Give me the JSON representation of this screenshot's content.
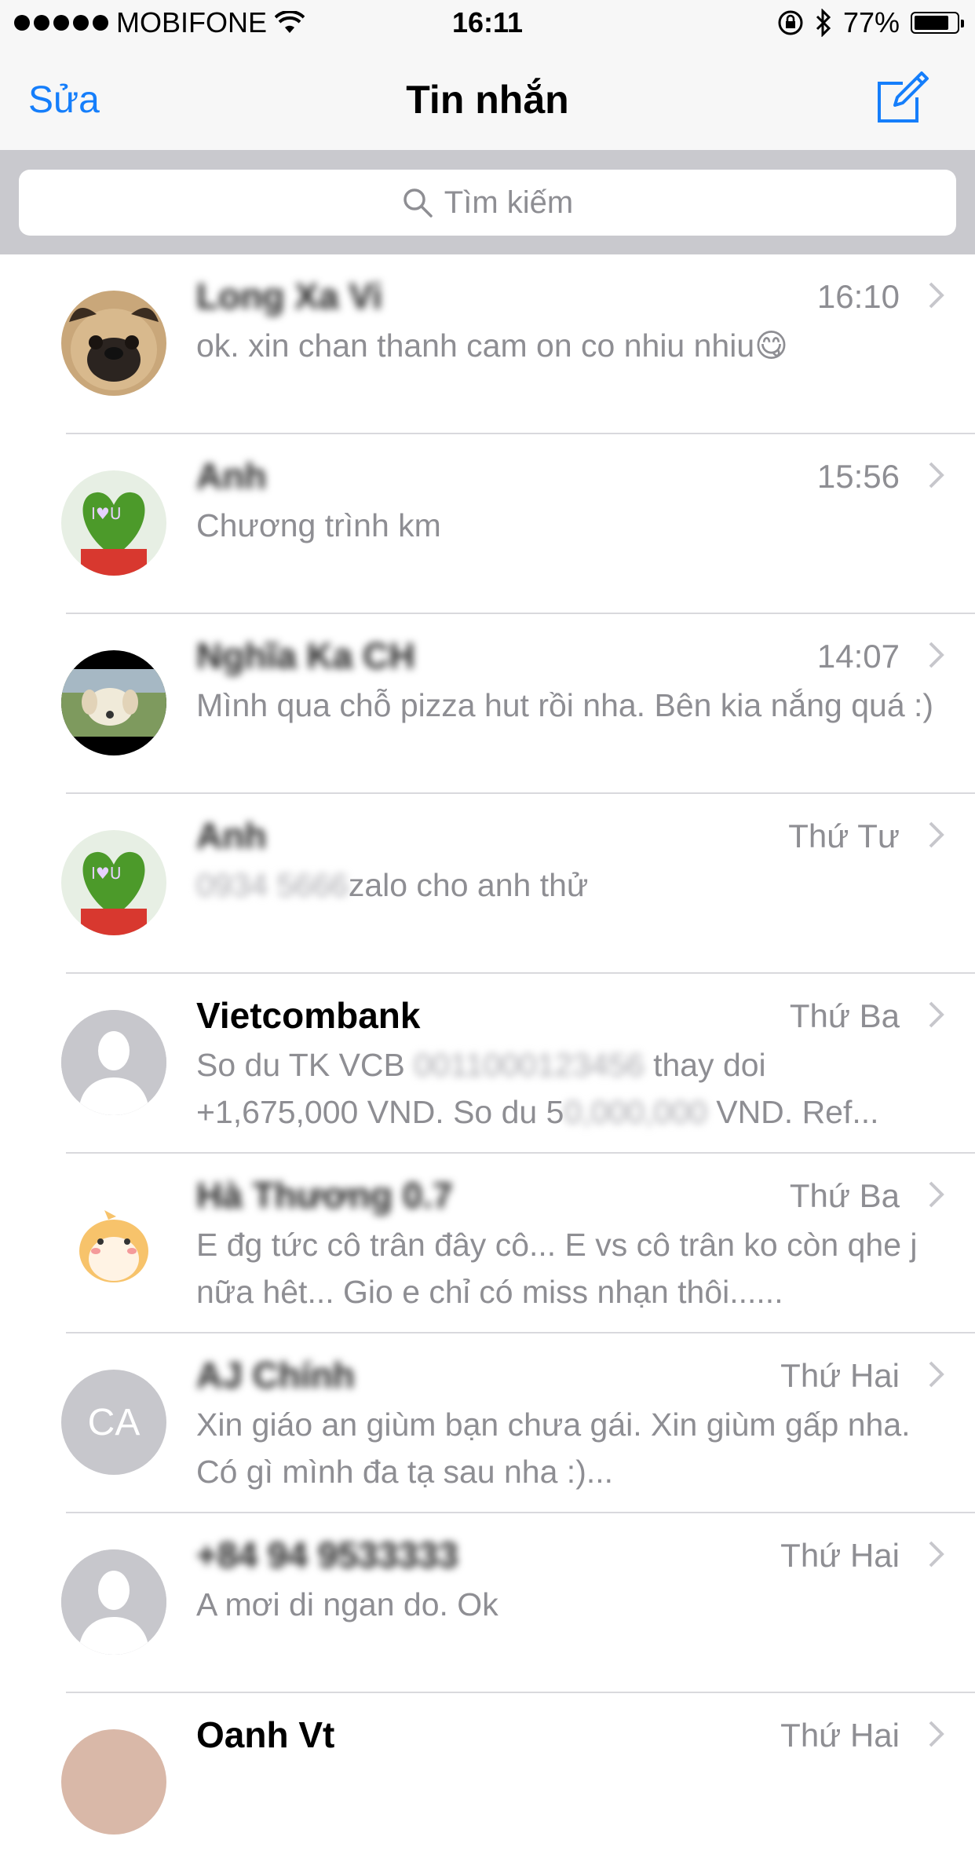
{
  "status_bar": {
    "carrier": "MOBIFONE",
    "time": "16:11",
    "battery": "77%",
    "battery_level": 0.77
  },
  "nav": {
    "edit_label": "Sửa",
    "title": "Tin nhắn",
    "compose_icon": "compose-icon"
  },
  "search": {
    "placeholder": "Tìm kiếm"
  },
  "accent_color": "#157efb",
  "conversations": [
    {
      "name": "Long Xa Vi",
      "time": "16:10",
      "preview": "ok. xin chan thanh cam on co nhiu nhiu😋",
      "avatar": "pug-dog-photo",
      "name_blurred": true
    },
    {
      "name": "Anh",
      "time": "15:56",
      "preview": "Chương trình km",
      "avatar": "heart-cactus-photo",
      "name_blurred": true
    },
    {
      "name": "Nghĩa Ka CH",
      "time": "14:07",
      "preview": "Mình qua chỗ pizza hut rồi nha. Bên kia nắng quá :)",
      "avatar": "white-dog-photo",
      "name_blurred": true
    },
    {
      "name": "Anh",
      "time": "Thứ Tư",
      "preview_blurred": "0934 5666 ",
      "preview": "zalo cho anh thử",
      "avatar": "heart-cactus-photo",
      "name_blurred": true
    },
    {
      "name": "Vietcombank",
      "time": "Thứ Ba",
      "preview_line1_a": "So du TK VCB ",
      "preview_blur1": "0011000123456",
      "preview_line1_b": " thay doi",
      "preview_line2_a": "+1,675,000 VND. So du 5",
      "preview_blur2": "0,000,000",
      "preview_line2_b": " VND. Ref...",
      "avatar": "default-person-icon",
      "name_blurred": false
    },
    {
      "name": "Hà Thương 0.7",
      "time": "Thứ Ba",
      "preview": "E đg tức cô trân đây cô... E vs cô trân ko còn qhe j nữa hêt... Gio e chỉ có miss nhạn thôi......",
      "avatar": "cartoon-hamster-sticker",
      "name_blurred": true
    },
    {
      "name": "AJ Chính",
      "time": "Thứ Hai",
      "preview": "Xin giáo an giùm bạn chưa gái. Xin giùm gấp nha. Có gì mình đa tạ sau nha :)...",
      "avatar": "CA",
      "name_blurred": true
    },
    {
      "name": "+84 94 9533333",
      "time": "Thứ Hai",
      "preview": "A mơi di ngan do. Ok",
      "avatar": "default-person-icon",
      "name_blurred": true
    },
    {
      "name": "Oanh Vt",
      "time": "Thứ Hai",
      "preview": "",
      "avatar": "photo",
      "name_blurred": false
    }
  ]
}
